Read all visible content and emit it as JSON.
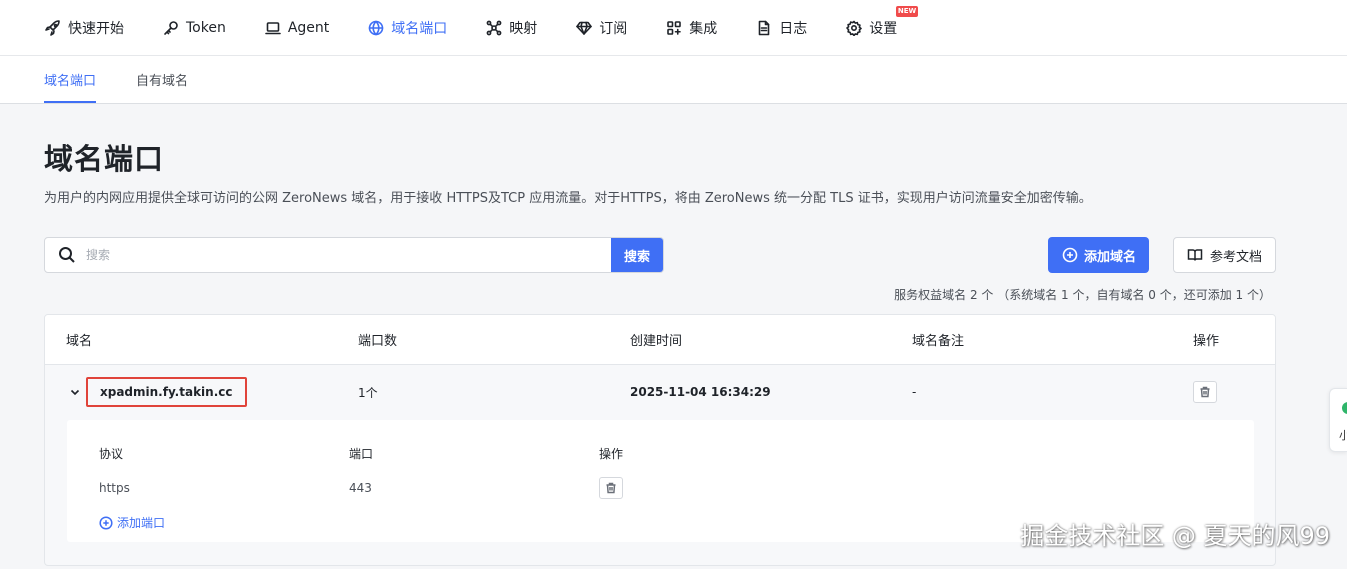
{
  "nav": {
    "items": [
      {
        "label": "快速开始",
        "icon": "rocket-icon"
      },
      {
        "label": "Token",
        "icon": "key-icon"
      },
      {
        "label": "Agent",
        "icon": "laptop-icon"
      },
      {
        "label": "域名端口",
        "icon": "globe-icon",
        "active": true
      },
      {
        "label": "映射",
        "icon": "network-icon"
      },
      {
        "label": "订阅",
        "icon": "diamond-icon"
      },
      {
        "label": "集成",
        "icon": "grid-plus-icon"
      },
      {
        "label": "日志",
        "icon": "document-icon"
      },
      {
        "label": "设置",
        "icon": "gear-icon"
      }
    ],
    "new_badge": "NEW"
  },
  "subnav": {
    "tabs": [
      "域名端口",
      "自有域名"
    ],
    "active_index": 0
  },
  "page": {
    "title": "域名端口",
    "description": "为用户的内网应用提供全球可访问的公网 ZeroNews 域名，用于接收 HTTPS及TCP 应用流量。对于HTTPS，将由 ZeroNews 统一分配 TLS 证书，实现用户访问流量安全加密传输。"
  },
  "search": {
    "placeholder": "搜索",
    "value": "",
    "button_label": "搜索"
  },
  "actions": {
    "add_domain_label": "添加域名",
    "docs_label": "参考文档"
  },
  "quota_text": "服务权益域名 2 个 （系统域名 1 个，自有域名 0 个，还可添加 1 个）",
  "table": {
    "headers": [
      "域名",
      "端口数",
      "创建时间",
      "域名备注",
      "操作"
    ],
    "rows": [
      {
        "domain": "xpadmin.fy.takin.cc",
        "port_count": "1个",
        "created_at": "2025-11-04 16:34:29",
        "remark": "-",
        "expanded": true,
        "sub": {
          "headers": [
            "协议",
            "端口",
            "操作"
          ],
          "rows": [
            {
              "protocol": "https",
              "port": "443"
            }
          ],
          "add_port_label": "添加端口"
        }
      }
    ]
  },
  "widget": {
    "text": "小"
  },
  "watermark": "掘金技术社区 @ 夏天的风99",
  "colors": {
    "accent": "#3f6ff5",
    "highlight_border": "#e0443a",
    "new_badge": "#f04b4b"
  }
}
